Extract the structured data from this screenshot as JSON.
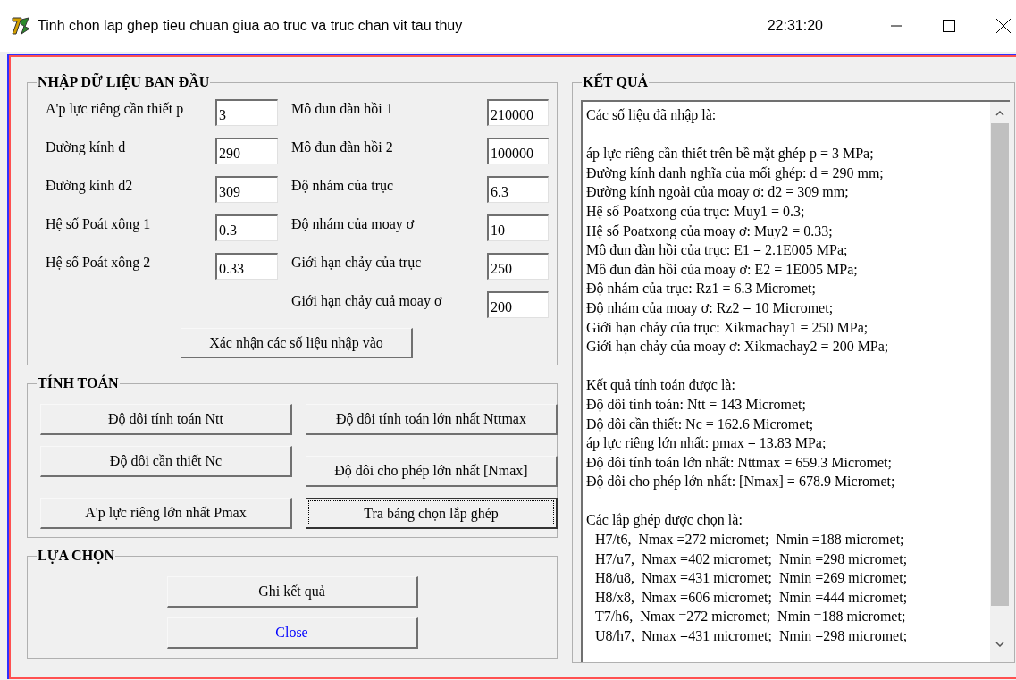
{
  "window": {
    "title": "Tinh chon lap ghep tieu chuan giua ao truc va truc chan vit tau thuy",
    "clock": "22:31:20"
  },
  "input_group": {
    "title": "NHẬP DỮ LIỆU BAN ĐẦU",
    "left_fields": [
      {
        "label": "A'p lực riêng cần thiết p",
        "value": "3"
      },
      {
        "label": "Đường kính d",
        "value": "290"
      },
      {
        "label": "Đường kính d2",
        "value": "309"
      },
      {
        "label": "Hệ số Poát xông 1",
        "value": "0.3"
      },
      {
        "label": "Hệ số Poát xông 2",
        "value": "0.33"
      }
    ],
    "right_fields": [
      {
        "label": "Mô đun đàn hồi 1",
        "value": "210000"
      },
      {
        "label": "Mô đun đàn hồi 2",
        "value": "100000"
      },
      {
        "label": "Độ nhám của trục",
        "value": "6.3"
      },
      {
        "label": "Độ nhám của moay ơ",
        "value": "10"
      },
      {
        "label": "Giới hạn chảy của trục",
        "value": "250"
      },
      {
        "label": "Giới hạn chảy cuả moay ơ",
        "value": "200"
      }
    ],
    "confirm_button": "Xác nhận các số liệu nhập vào"
  },
  "calc_group": {
    "title": "TÍNH TOÁN",
    "buttons": [
      {
        "label": "Độ dôi tính toán Ntt",
        "focused": false
      },
      {
        "label": "Độ dôi tính toán lớn nhất Nttmax",
        "focused": false
      },
      {
        "label": "Độ dôi cần thiết Nc",
        "focused": false
      },
      {
        "label": "Độ dôi cho phép lớn nhất [Nmax]",
        "focused": false
      },
      {
        "label": "A'p lực riêng lớn nhất Pmax",
        "focused": false
      },
      {
        "label": "Tra bảng chọn lắp ghép",
        "focused": true
      }
    ]
  },
  "choice_group": {
    "title": "LỰA CHỌN",
    "buttons": [
      {
        "label": "Ghi kết quả",
        "color": "#000000"
      },
      {
        "label": "Close",
        "color": "#0000ff"
      }
    ]
  },
  "result_group": {
    "title": "KẾT QUẢ",
    "sections": [
      {
        "indented": false,
        "lines": [
          "Các số liệu đã nhập là:"
        ]
      },
      {
        "indented": false,
        "lines": [
          "áp lực riêng cần thiết trên bề mặt ghép p = 3 MPa;",
          "Đường kính danh nghĩa của mối ghép: d = 290 mm;",
          "Đường kính ngoài của moay ơ: d2 = 309 mm;",
          "Hệ số Poatxong của trục: Muy1 = 0.3;",
          "Hệ số Poatxong của moay ơ: Muy2 = 0.33;",
          "Mô đun đàn hồi của trục: E1 = 2.1E005 MPa;",
          "Mô đun đàn hồi của moay ơ: E2 = 1E005 MPa;",
          "Độ nhám của trục: Rz1 = 6.3 Micromet;",
          "Độ nhám của moay ơ: Rz2 = 10 Micromet;",
          "Giới hạn chảy của trục: Xikmachay1 = 250 MPa;",
          "Giới hạn chảy của moay ơ: Xikmachay2 = 200 MPa;"
        ]
      },
      {
        "indented": false,
        "lines": [
          "Kết quả tính toán được là:",
          "Độ dôi tính toán: Ntt = 143 Micromet;",
          "Độ dôi cần thiết: Nc = 162.6 Micromet;",
          "áp lực riêng lớn nhất: pmax = 13.83 MPa;",
          "Độ dôi tính toán lớn nhất: Nttmax = 659.3 Micromet;",
          "Độ dôi cho phép lớn nhất: [Nmax] = 678.9 Micromet;"
        ]
      },
      {
        "indented": false,
        "lines": [
          "Các lắp ghép được chọn là:"
        ]
      },
      {
        "indented": true,
        "lines": [
          "H7/t6,  Nmax =272 micromet;  Nmin =188 micromet;",
          "H7/u7,  Nmax =402 micromet;  Nmin =298 micromet;",
          "H8/u8,  Nmax =431 micromet;  Nmin =269 micromet;",
          "H8/x8,  Nmax =606 micromet;  Nmin =444 micromet;",
          "T7/h6,  Nmax =272 micromet;  Nmin =188 micromet;",
          "U8/h7,  Nmax =431 micromet;  Nmin =298 micromet;"
        ]
      }
    ]
  }
}
